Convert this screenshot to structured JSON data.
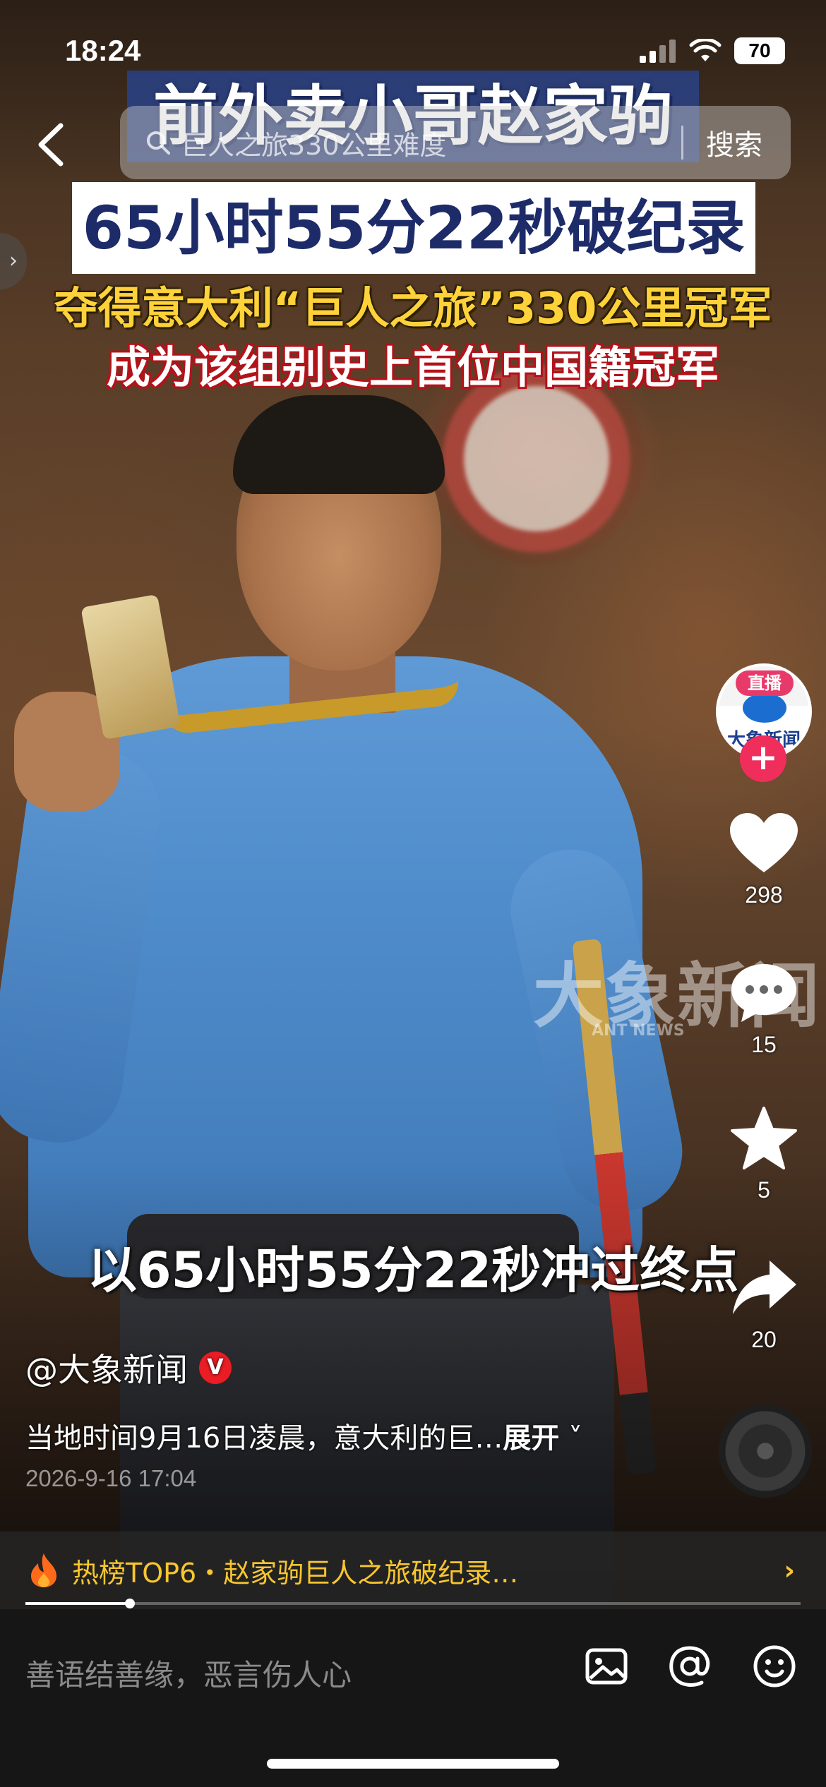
{
  "status_bar": {
    "time": "18:24",
    "battery": "70"
  },
  "search": {
    "query": "巨人之旅330公里难度",
    "button": "搜索"
  },
  "video": {
    "caption_line1": "前外卖小哥赵家驹",
    "caption_line2": "65小时55分22秒破纪录",
    "caption_line3": "夺得意大利“巨人之旅”330公里冠军",
    "caption_line4": "成为该组别史上首位中国籍冠军",
    "subtitle": "以65小时55分22秒冲过终点",
    "watermark": "大象新闻",
    "watermark_sub": "ANT NEWS"
  },
  "avatar": {
    "live_label": "直播",
    "name": "大象新闻",
    "follow": "+"
  },
  "actions": {
    "likes": "298",
    "comments": "15",
    "favorites": "5",
    "shares": "20"
  },
  "post": {
    "author": "@大象新闻",
    "verified": "V",
    "description": "当地时间9月16日凌晨，意大利的巨…",
    "expand": "展开",
    "timestamp": "2026-9-16 17:04"
  },
  "hot_rank": {
    "text": "热榜TOP6・赵家驹巨人之旅破纪录…",
    "arrow": "›"
  },
  "playback": {
    "progress": 0.135
  },
  "comment_bar": {
    "placeholder": "善语结善缘，恶言伤人心"
  },
  "colors": {
    "accent": "#f02e5c",
    "hot": "#f8c62e",
    "verified": "#ea1c24"
  }
}
